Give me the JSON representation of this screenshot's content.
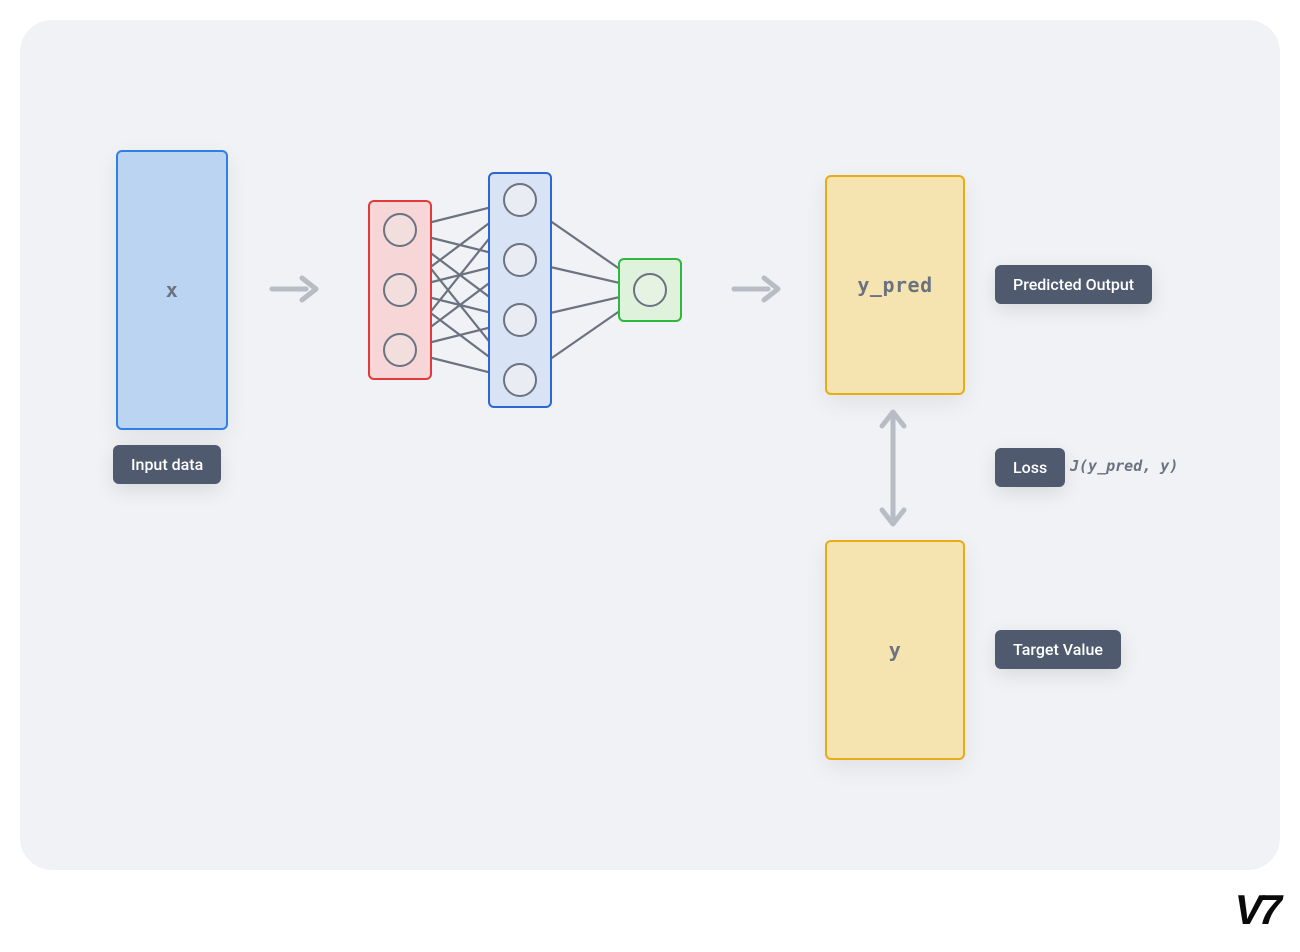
{
  "boxes": {
    "input": {
      "text": "x"
    },
    "ypred": {
      "text": "y_pred"
    },
    "target": {
      "text": "y"
    }
  },
  "labels": {
    "input": "Input data",
    "predicted": "Predicted Output",
    "loss": "Loss",
    "target": "Target Value"
  },
  "formula": {
    "loss": "J(y_pred, y)"
  },
  "logo": "V7",
  "colors": {
    "canvas_bg": "#f0f2f5",
    "box_blue_fill": "#bad4f2",
    "box_blue_border": "#2f7fe6",
    "box_red_fill": "#f6d6d6",
    "box_red_border": "#e13a3a",
    "box_mid_blue_fill": "#d8e3f5",
    "box_mid_blue_border": "#2f66d6",
    "box_green_fill": "#dff2dc",
    "box_green_border": "#2fb83e",
    "box_yellow_fill": "#f6e4b0",
    "box_yellow_border": "#e8ac17",
    "label_bg": "#4f5a6e",
    "neuron_border": "#6b7280",
    "arrow": "#b8bcc4"
  },
  "network": {
    "layers": [
      3,
      4,
      1
    ]
  }
}
